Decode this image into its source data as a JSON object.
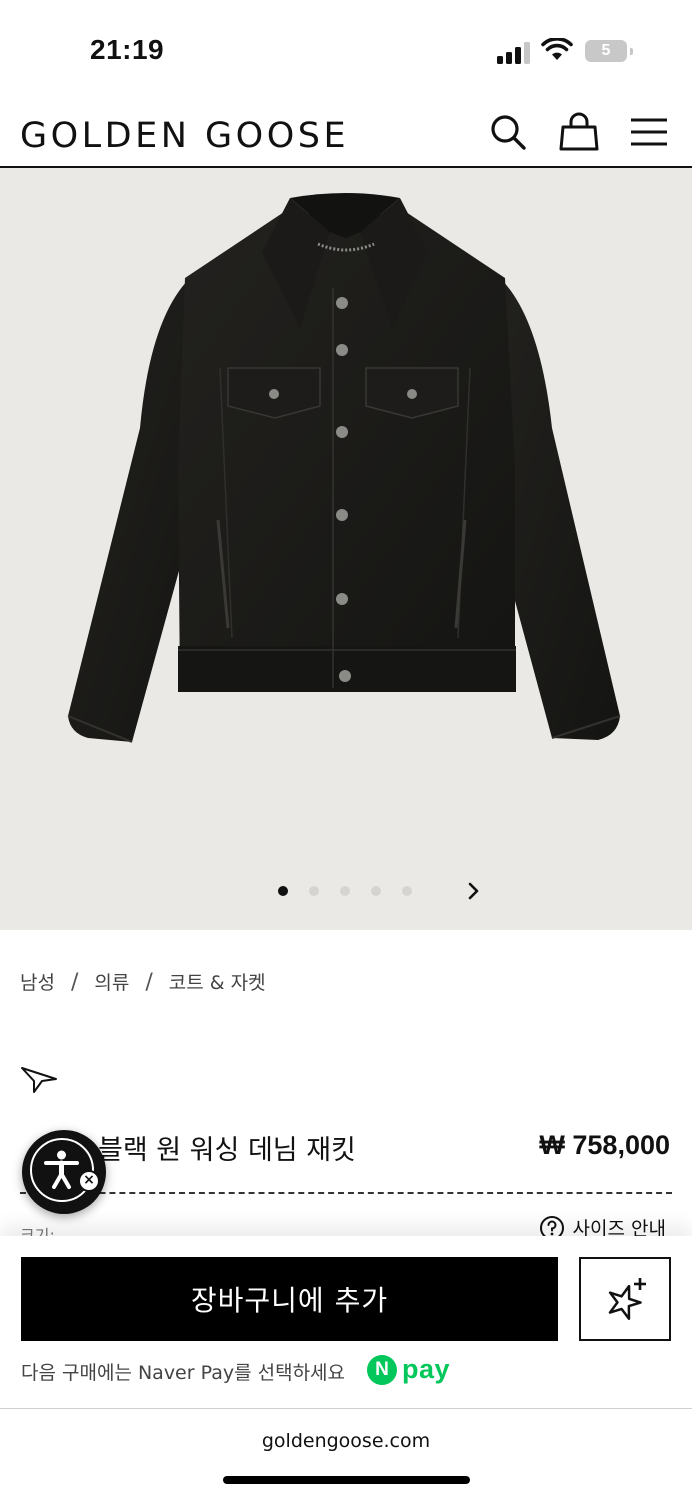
{
  "status_bar": {
    "time": "21:19",
    "battery": "5"
  },
  "header": {
    "brand": "GOLDEN GOOSE",
    "icons": [
      "search-icon",
      "bag-icon",
      "menu-icon"
    ]
  },
  "gallery": {
    "dot_count": 5,
    "active_index": 0
  },
  "breadcrumb": {
    "items": [
      "남성",
      "의류",
      "코트 & 자켓"
    ],
    "separator": "/"
  },
  "product": {
    "title_visible": "블랙 원 워싱 데님 재킷",
    "price": "₩ 758,000",
    "size_label": "크기:",
    "size_guide": "사이즈 안내"
  },
  "actions": {
    "add_to_cart": "장바구니에 추가",
    "naver_pay_text": "다음 구매에는 Naver Pay를 선택하세요",
    "npay_logo_n": "N",
    "npay_logo_text": "pay"
  },
  "browser": {
    "url": "goldengoose.com"
  },
  "colors": {
    "brand_black": "#000000",
    "naver_green": "#03c75a",
    "hero_bg": "#ebe9e5"
  }
}
